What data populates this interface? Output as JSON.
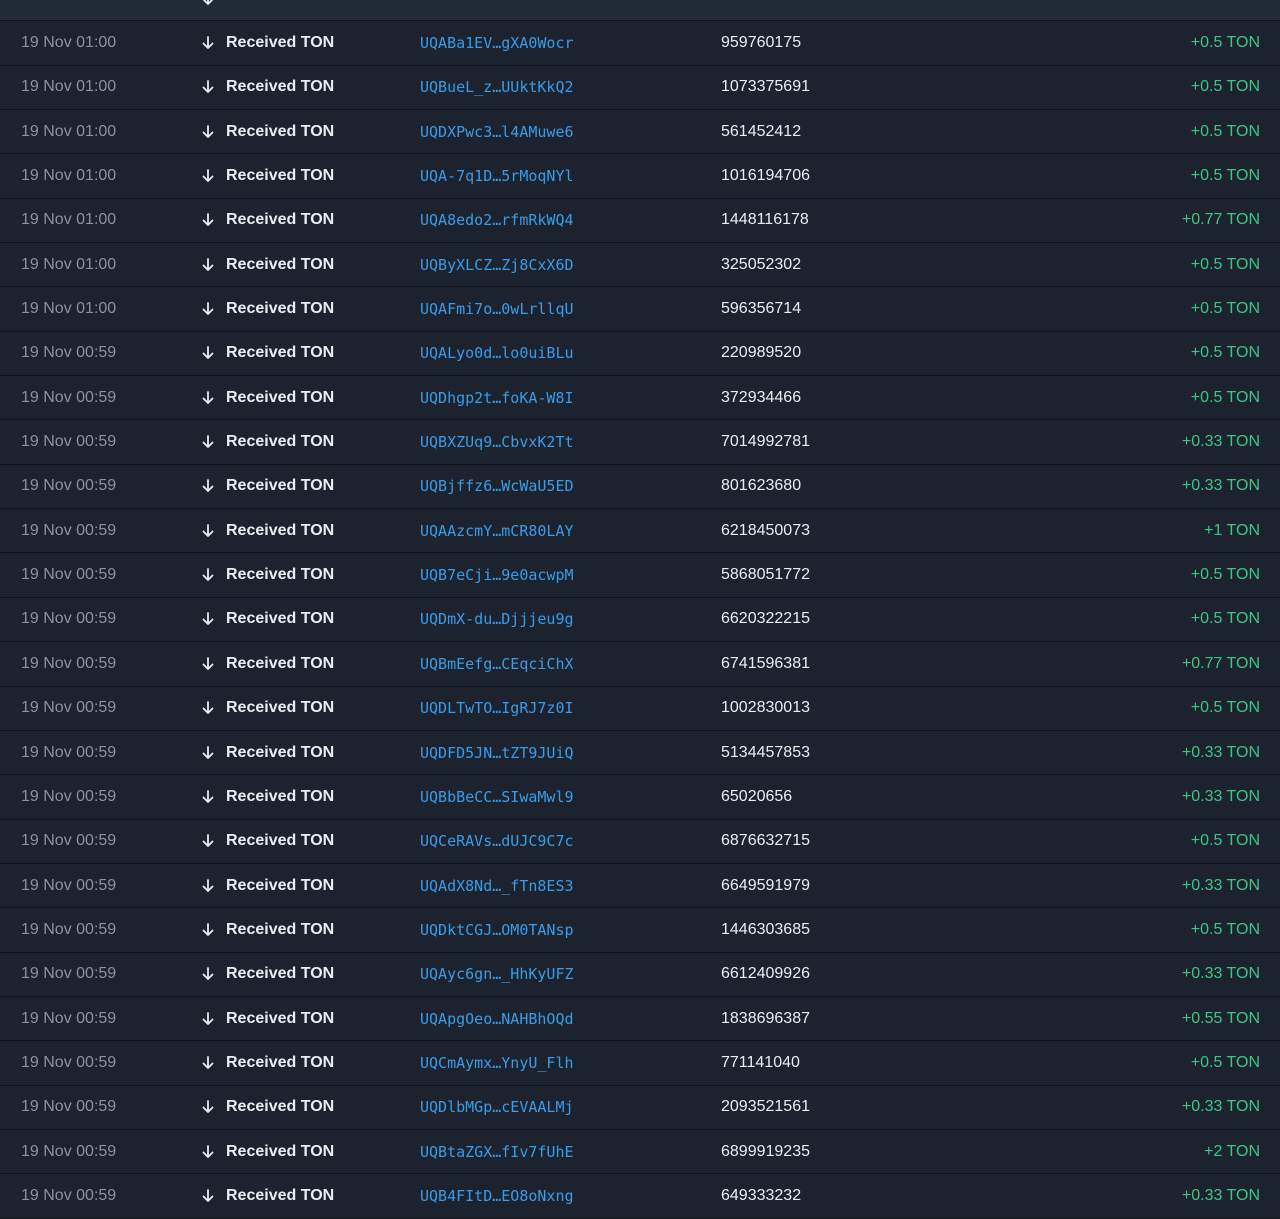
{
  "colors": {
    "background": "#1c232e",
    "row_divider": "#0f141b",
    "time_text": "#8b939e",
    "primary_text": "#e9edf2",
    "address_link": "#3a9be8",
    "amount_positive": "#3ec583"
  },
  "icons": {
    "received": "arrow-down-icon"
  },
  "transactions": [
    {
      "time": "",
      "action": "",
      "address": "",
      "comment": "",
      "amount": ""
    },
    {
      "time": "19 Nov 01:00",
      "action": "Received TON",
      "address": "UQABa1EV…gXA0Wocr",
      "comment": "959760175",
      "amount": "+0.5 TON"
    },
    {
      "time": "19 Nov 01:00",
      "action": "Received TON",
      "address": "UQBueL_z…UUktKkQ2",
      "comment": "1073375691",
      "amount": "+0.5 TON"
    },
    {
      "time": "19 Nov 01:00",
      "action": "Received TON",
      "address": "UQDXPwc3…l4AMuwe6",
      "comment": "561452412",
      "amount": "+0.5 TON"
    },
    {
      "time": "19 Nov 01:00",
      "action": "Received TON",
      "address": "UQA-7q1D…5rMoqNYl",
      "comment": "1016194706",
      "amount": "+0.5 TON"
    },
    {
      "time": "19 Nov 01:00",
      "action": "Received TON",
      "address": "UQA8edo2…rfmRkWQ4",
      "comment": "1448116178",
      "amount": "+0.77 TON"
    },
    {
      "time": "19 Nov 01:00",
      "action": "Received TON",
      "address": "UQByXLCZ…Zj8CxX6D",
      "comment": "325052302",
      "amount": "+0.5 TON"
    },
    {
      "time": "19 Nov 01:00",
      "action": "Received TON",
      "address": "UQAFmi7o…0wLrllqU",
      "comment": "596356714",
      "amount": "+0.5 TON"
    },
    {
      "time": "19 Nov 00:59",
      "action": "Received TON",
      "address": "UQALyo0d…lo0uiBLu",
      "comment": "220989520",
      "amount": "+0.5 TON"
    },
    {
      "time": "19 Nov 00:59",
      "action": "Received TON",
      "address": "UQDhgp2t…foKA-W8I",
      "comment": "372934466",
      "amount": "+0.5 TON"
    },
    {
      "time": "19 Nov 00:59",
      "action": "Received TON",
      "address": "UQBXZUq9…CbvxK2Tt",
      "comment": "7014992781",
      "amount": "+0.33 TON"
    },
    {
      "time": "19 Nov 00:59",
      "action": "Received TON",
      "address": "UQBjffz6…WcWaU5ED",
      "comment": "801623680",
      "amount": "+0.33 TON"
    },
    {
      "time": "19 Nov 00:59",
      "action": "Received TON",
      "address": "UQAAzcmY…mCR80LAY",
      "comment": "6218450073",
      "amount": "+1 TON"
    },
    {
      "time": "19 Nov 00:59",
      "action": "Received TON",
      "address": "UQB7eCji…9e0acwpM",
      "comment": "5868051772",
      "amount": "+0.5 TON"
    },
    {
      "time": "19 Nov 00:59",
      "action": "Received TON",
      "address": "UQDmX-du…Djjjeu9g",
      "comment": "6620322215",
      "amount": "+0.5 TON"
    },
    {
      "time": "19 Nov 00:59",
      "action": "Received TON",
      "address": "UQBmEefg…CEqciChX",
      "comment": "6741596381",
      "amount": "+0.77 TON"
    },
    {
      "time": "19 Nov 00:59",
      "action": "Received TON",
      "address": "UQDLTwTO…IgRJ7z0I",
      "comment": "1002830013",
      "amount": "+0.5 TON"
    },
    {
      "time": "19 Nov 00:59",
      "action": "Received TON",
      "address": "UQDFD5JN…tZT9JUiQ",
      "comment": "5134457853",
      "amount": "+0.33 TON"
    },
    {
      "time": "19 Nov 00:59",
      "action": "Received TON",
      "address": "UQBbBeCC…SIwaMwl9",
      "comment": "65020656",
      "amount": "+0.33 TON"
    },
    {
      "time": "19 Nov 00:59",
      "action": "Received TON",
      "address": "UQCeRAVs…dUJC9C7c",
      "comment": "6876632715",
      "amount": "+0.5 TON"
    },
    {
      "time": "19 Nov 00:59",
      "action": "Received TON",
      "address": "UQAdX8Nd…_fTn8ES3",
      "comment": "6649591979",
      "amount": "+0.33 TON"
    },
    {
      "time": "19 Nov 00:59",
      "action": "Received TON",
      "address": "UQDktCGJ…OM0TANsp",
      "comment": "1446303685",
      "amount": "+0.5 TON"
    },
    {
      "time": "19 Nov 00:59",
      "action": "Received TON",
      "address": "UQAyc6gn…_HhKyUFZ",
      "comment": "6612409926",
      "amount": "+0.33 TON"
    },
    {
      "time": "19 Nov 00:59",
      "action": "Received TON",
      "address": "UQApgOeo…NAHBhOQd",
      "comment": "1838696387",
      "amount": "+0.55 TON"
    },
    {
      "time": "19 Nov 00:59",
      "action": "Received TON",
      "address": "UQCmAymx…YnyU_Flh",
      "comment": "771141040",
      "amount": "+0.5 TON"
    },
    {
      "time": "19 Nov 00:59",
      "action": "Received TON",
      "address": "UQDlbMGp…cEVAALMj",
      "comment": "2093521561",
      "amount": "+0.33 TON"
    },
    {
      "time": "19 Nov 00:59",
      "action": "Received TON",
      "address": "UQBtaZGX…fIv7fUhE",
      "comment": "6899919235",
      "amount": "+2 TON"
    },
    {
      "time": "19 Nov 00:59",
      "action": "Received TON",
      "address": "UQB4FItD…EO8oNxng",
      "comment": "649333232",
      "amount": "+0.33 TON"
    }
  ]
}
